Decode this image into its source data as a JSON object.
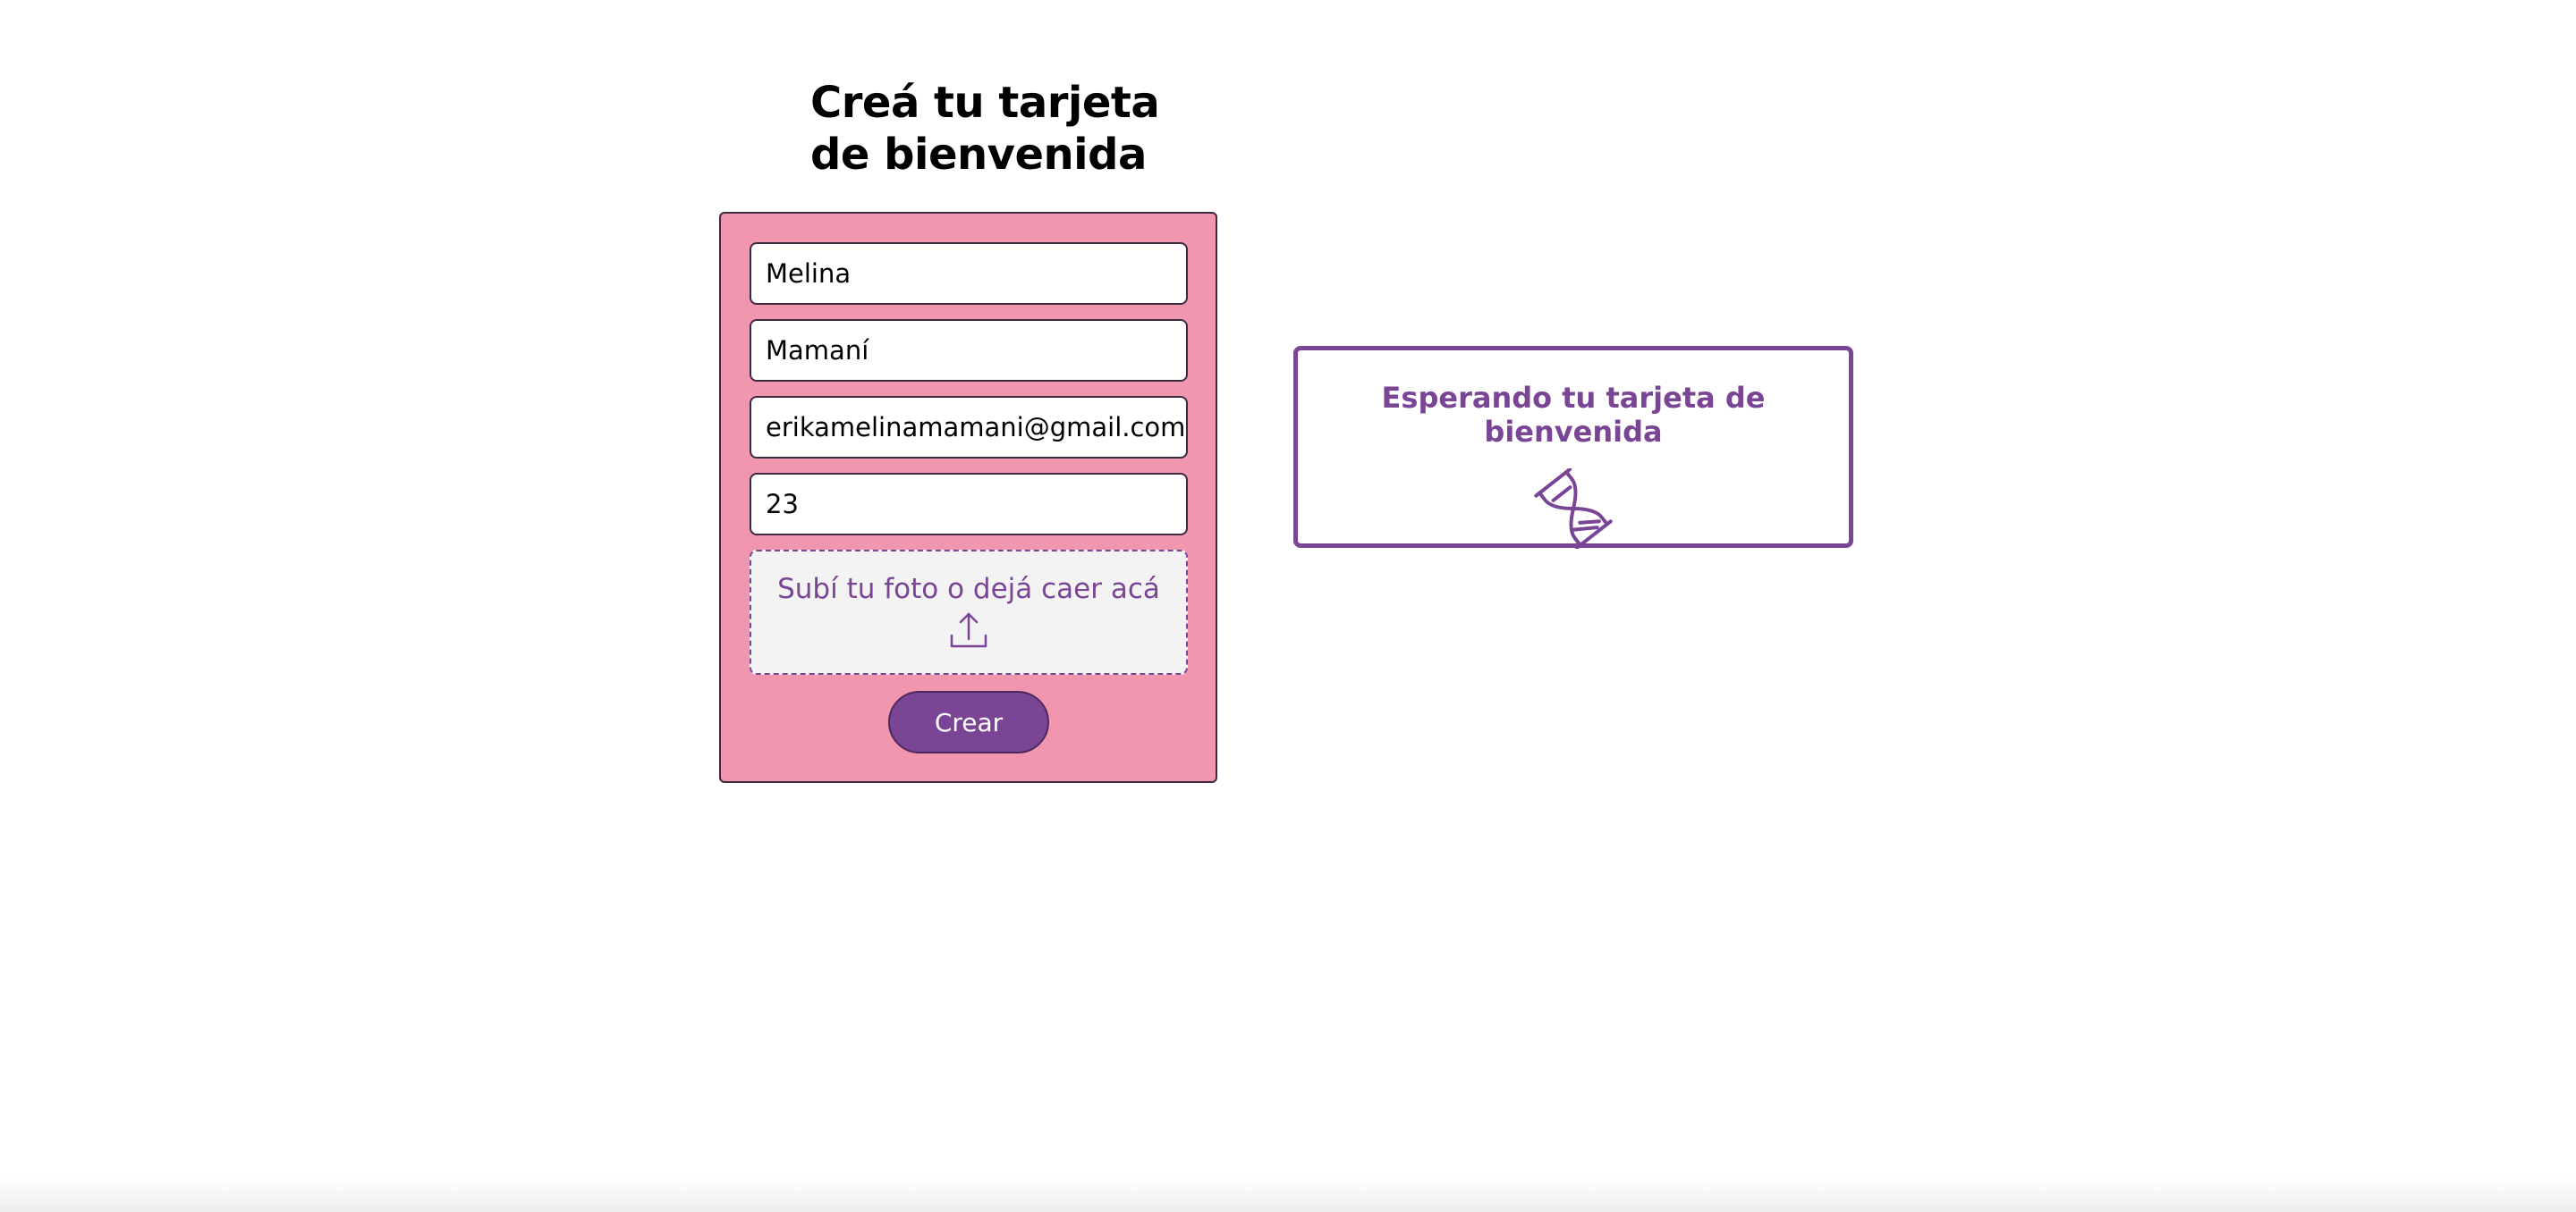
{
  "page": {
    "title_line1": "Creá tu tarjeta",
    "title_line2": "de bienvenida"
  },
  "form": {
    "first_name": "Melina",
    "last_name": "Mamaní",
    "email": "erikamelinamamani@gmail.com",
    "age": "23",
    "upload_label": "Subí tu foto o dejá caer acá",
    "upload_icon": "upload-icon",
    "submit_label": "Crear"
  },
  "preview": {
    "title": "Esperando tu tarjeta de bienvenida",
    "icon": "hourglass-icon"
  },
  "colors": {
    "form_background": "#f096ae",
    "accent": "#7a4594",
    "border": "#3b2a40"
  }
}
